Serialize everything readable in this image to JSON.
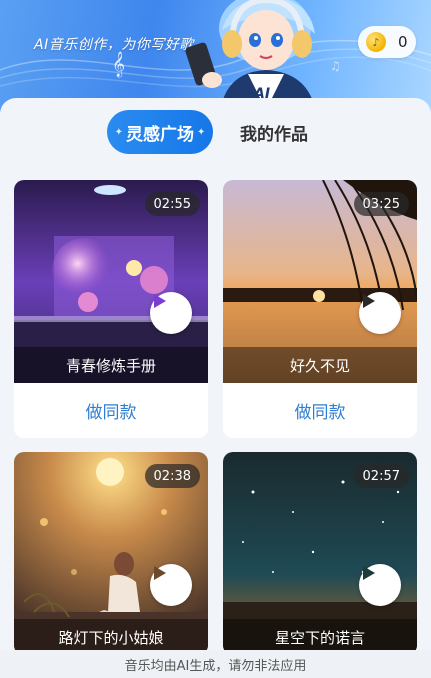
{
  "header": {
    "slogan": "AI音乐创作，为你写好歌",
    "coin_count": "0"
  },
  "tabs": [
    {
      "label": "灵感广场",
      "active": true
    },
    {
      "label": "我的作品",
      "active": false
    }
  ],
  "cards": [
    {
      "title": "青春修炼手册",
      "duration": "02:55",
      "action": "做同款"
    },
    {
      "title": "好久不见",
      "duration": "03:25",
      "action": "做同款"
    },
    {
      "title": "路灯下的小姑娘",
      "duration": "02:38"
    },
    {
      "title": "星空下的诺言",
      "duration": "02:57"
    }
  ],
  "footer": {
    "note": "音乐均由AI生成，请勿非法应用"
  },
  "colors": {
    "accent": "#1677e8",
    "link": "#2e7fd1"
  }
}
